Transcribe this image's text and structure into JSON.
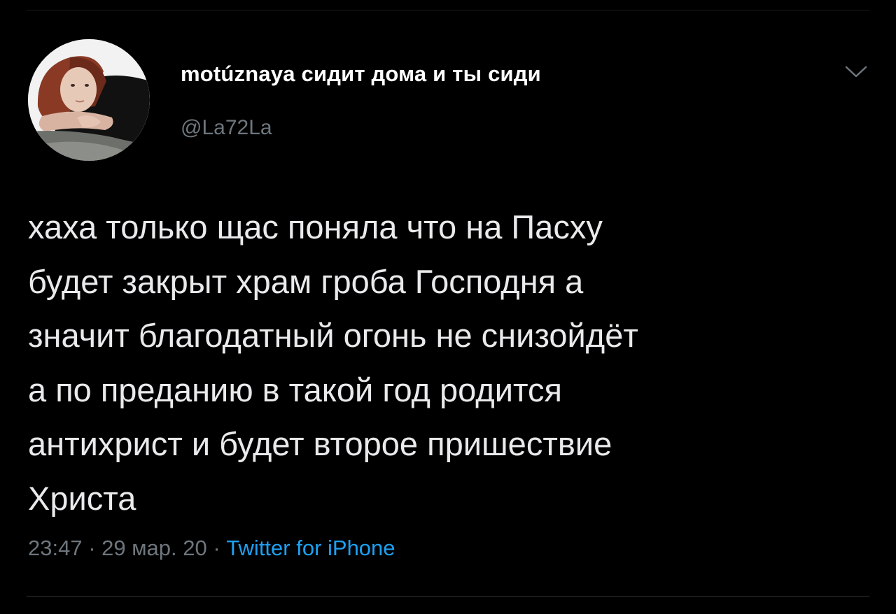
{
  "author": {
    "display_name": "motúznaya сидит дома и ты сиди",
    "handle": "@La72La"
  },
  "tweet": {
    "lines": [
      "хаха только щас поняла что на Пасху",
      "будет закрыт храм гроба Господня а",
      "значит благодатный огонь не снизойдёт",
      "а по преданию в такой год родится",
      "антихрист и будет второе пришествие",
      "Христа"
    ]
  },
  "meta": {
    "time": "23:47",
    "date": "29 мар. 20",
    "separator": " · ",
    "source": "Twitter for iPhone"
  },
  "icons": {
    "menu": "chevron-down-icon"
  },
  "colors": {
    "background": "#000000",
    "text": "#e9eaeb",
    "muted": "#6e767d",
    "link": "#1da1f2"
  }
}
